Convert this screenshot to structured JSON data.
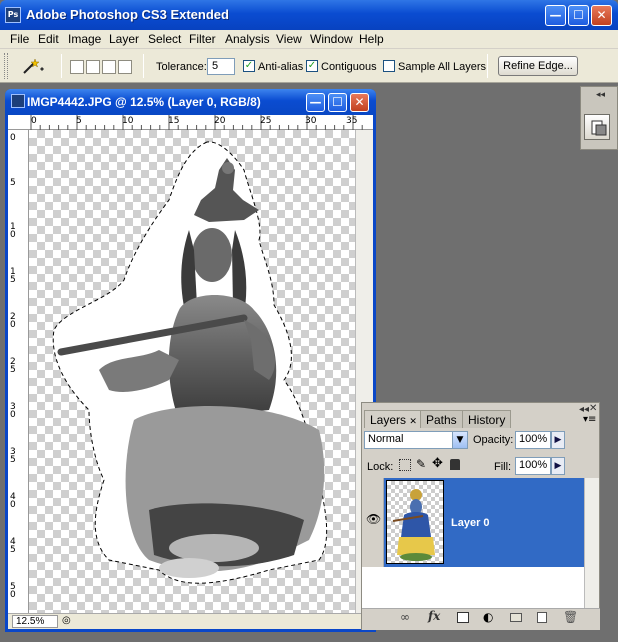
{
  "app": {
    "title": "Adobe Photoshop CS3 Extended",
    "icon_text": "Ps"
  },
  "window_controls": {
    "minimize": "—",
    "maximize": "☐",
    "close": "✕"
  },
  "menu": [
    "File",
    "Edit",
    "Image",
    "Layer",
    "Select",
    "Filter",
    "Analysis",
    "View",
    "Window",
    "Help"
  ],
  "options": {
    "tool_icon": "magic-wand-icon",
    "tolerance_label": "Tolerance:",
    "tolerance_value": "5",
    "antialias_label": "Anti-alias",
    "antialias_checked": true,
    "contiguous_label": "Contiguous",
    "contiguous_checked": true,
    "sample_all_label": "Sample All Layers",
    "sample_all_checked": false,
    "refine_edge_label": "Refine Edge..."
  },
  "document": {
    "title": "IMGP4442.JPG @ 12.5% (Layer 0, RGB/8)",
    "zoom": "12.5%",
    "ruler_h_labels": [
      "0",
      "5",
      "10",
      "15",
      "20",
      "25",
      "30",
      "35"
    ],
    "ruler_v_labels": [
      "0",
      "5",
      "10",
      "15",
      "20",
      "25",
      "30",
      "35",
      "40",
      "45",
      "50"
    ]
  },
  "layers_panel": {
    "tabs": [
      "Layers",
      "Paths",
      "History"
    ],
    "active_tab": "Layers",
    "blend_mode": "Normal",
    "opacity_label": "Opacity:",
    "opacity_value": "100%",
    "lock_label": "Lock:",
    "fill_label": "Fill:",
    "fill_value": "100%",
    "layers": [
      {
        "name": "Layer 0",
        "visible": true,
        "selected": true
      }
    ]
  },
  "colors": {
    "titlebar": "#0a4cd1",
    "selection": "#316ac5",
    "chrome": "#ece9d8"
  }
}
